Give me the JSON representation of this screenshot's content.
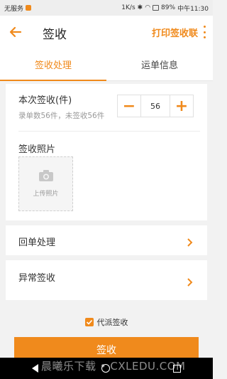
{
  "status_bar": {
    "carrier": "无服务",
    "speed": "1K/s",
    "battery": "89%",
    "time": "中午11:30"
  },
  "header": {
    "title": "签收",
    "print_label": "打印签收联"
  },
  "tabs": [
    {
      "label": "签收处理",
      "active": true
    },
    {
      "label": "运单信息",
      "active": false
    }
  ],
  "sign_section": {
    "qty_label": "本次签收(件)",
    "qty_sub": "录单数56件，未签收56件",
    "qty_value": "56",
    "photo_label": "签收照片",
    "upload_label": "上传照片"
  },
  "rows": [
    {
      "label": "回单处理"
    },
    {
      "label": "异常签收"
    }
  ],
  "checkbox": {
    "label": "代派签收",
    "checked": true
  },
  "submit_label": "签收",
  "watermark": "晨曦乐下载 • CXLEDU.COM",
  "colors": {
    "accent": "#f08a1c"
  }
}
